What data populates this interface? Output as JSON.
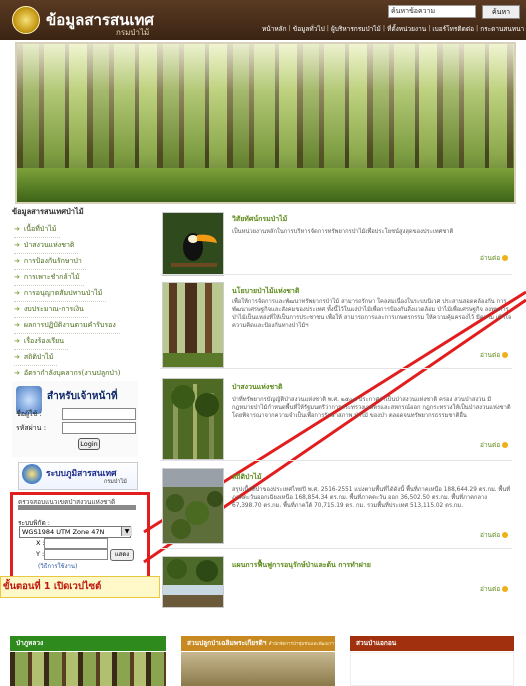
{
  "header": {
    "site_title": "ข้อมูลสารสนเทศ",
    "site_subtitle": "กรมป่าไม้",
    "search_placeholder": "ค้นหาข้อความ",
    "search_button": "ค้นหา",
    "nav": [
      "หน้าหลัก",
      "ข้อมูลทั่วไป",
      "ผู้บริหารกรมป่าไม้",
      "ที่ตั้งหน่วยงาน",
      "เบอร์โทรติดต่อ",
      "กระดานสนทนา"
    ]
  },
  "sidebar": {
    "title": "ข้อมูลสารสนเทศป่าไม้",
    "items": [
      {
        "label": "เนื้อที่ป่าไม้"
      },
      {
        "label": "ป่าสงวนแห่งชาติ"
      },
      {
        "label": "การป้องกันรักษาป่า"
      },
      {
        "label": "การเพาะชำกล้าไม้"
      },
      {
        "label": "การอนุญาตสัมปทานป่าไม้"
      },
      {
        "label": "งบประมาณ-การเงิน"
      },
      {
        "label": "ผลการปฏิบัติงานตามคำรับรอง"
      },
      {
        "label": "เรื่องร้องเรียน"
      },
      {
        "label": "สถิติป่าไม้"
      },
      {
        "label": "อัตรากำลังบุคลากร(งานปลูกป่า)"
      }
    ]
  },
  "login": {
    "title": "สำหรับเจ้าหน้าที่",
    "user_label": "ชื่อผู้ใช้ :",
    "pass_label": "รหัสผ่าน :",
    "button": "Login"
  },
  "gis": {
    "title": "ระบบภูมิสารสนเทศ",
    "subtitle": "กรมป่าไม้"
  },
  "coord_search": {
    "title": "ตรวจสอบแนวเขตป่าสงวนแห่งชาติ",
    "system_label": "ระบบพิกัด :",
    "selected": "WGS1984 UTM Zone 47N",
    "x_label": "X :",
    "y_label": "Y :",
    "button": "แสดง",
    "howto": "(วิธีการใช้งาน)"
  },
  "step_caption": "ขั้นตอนที่ 1 เปิดเวปไซต์",
  "articles": [
    {
      "title": "วิสัยทัศน์กรมป่าไม้",
      "text": "เป็นหน่วยงานหลักในการบริหารจัดการทรัพยากรป่าไม้เพื่อประโยชน์สูงสุดของประเทศชาติ",
      "readmore": "อ่านต่อ"
    },
    {
      "title": "นโยบายป่าไม้แห่งชาติ",
      "text": "เพื่อให้การจัดการและพัฒนาทรัพยากรป่าไม้ สามารถรักษา ใคลสมเนื่องในระบบนิเวศ ประสานสอดคล้องกัน การพัฒนาเศรษฐกิจและสังคมของประเทศ ทั้งนี้ไว้ในแง่ป่าไม้เพื่อการป้องกันสิ่งแวดล้อม ป่าไม้เพื่อเศรษฐกิจ ลงทุนการ ป่าไม้เป็นแหล่งที่ให้เป็นการประชาชน เพื่อให้ สามารถการและการเกษตรกรรม ให้ความคุ้มครองไว้ มีความ เข้าใจความคิดและป้องกันทางป่าไม้ฯ",
      "readmore": "อ่านต่อ"
    },
    {
      "title": "ป่าสงวนแห่งชาติ",
      "text": "ป่าที่ทรัพยากรบัญญัติป่าสงวนแห่งชาติ พ.ศ. ๒๕๐๗ ประกาศว่าเป็นป่าสงวนแห่งชาติ ครอง สวนป่าสงวน มีกฎหมายป่าไม้กำหนดพื้นที่ให้รัฐมนตรีว่าการกระทรวงเกษตรและสหกรณ์ออก กฎกระทรวงให้เป็นป่าสงวนแห่งชาติ โดยพิจารณาจากความจำเป็นเพื่อการรักษาสภาพ ป่าไม้ ของป่า ตลอดจนทรัพยากรธรรมชาติอื่น",
      "readmore": "อ่านต่อ"
    },
    {
      "title": "สถิติป่าไม้",
      "text": "สรุปเนื้อที่ป่าของประเทศไทยปี พ.ศ. 2516-2551 แบ่งตามพื้นที่ได้ดังนี้ พื้นที่ภาคเหนือ 188,644.29 ตร.กม. พื้นที่ภาคตะวันออกเฉียงเหนือ 168,854.34 ตร.กม. พื้นที่ภาคตะวัน ออก 36,502.50 ตร.กม. พื้นที่ภาคกลาง 67,398.70 ตร.กม. พื้นที่ภาคใต้ 70,715.19 ตร. กม. รวมพื้นที่ประเทศ 513,115.02 ตร.กม.",
      "readmore": "อ่านต่อ"
    },
    {
      "title": "แผนการฟื้นฟูการอนุรักษ์ป่าและต้น การทำฝาย",
      "text": "",
      "readmore": "อ่านต่อ"
    }
  ],
  "bottom_boxes": [
    {
      "title": "ป่าภูหลวง",
      "color": "#2f8a1e"
    },
    {
      "title": "สวนปลูกป่าเฉลิมพระเกียรติฯ",
      "subtitle": "สำนักจัดการป่าชุมชนและพัฒนาฯ",
      "color": "#c88a20"
    },
    {
      "title": "สวนป่าแอกอน",
      "color": "#a0300e"
    }
  ],
  "colors": {
    "header_bg": "#4a2f1b",
    "link_green": "#5c8a1a",
    "highlight_red": "#e21d1d",
    "caption_bg": "#fff8c8"
  }
}
